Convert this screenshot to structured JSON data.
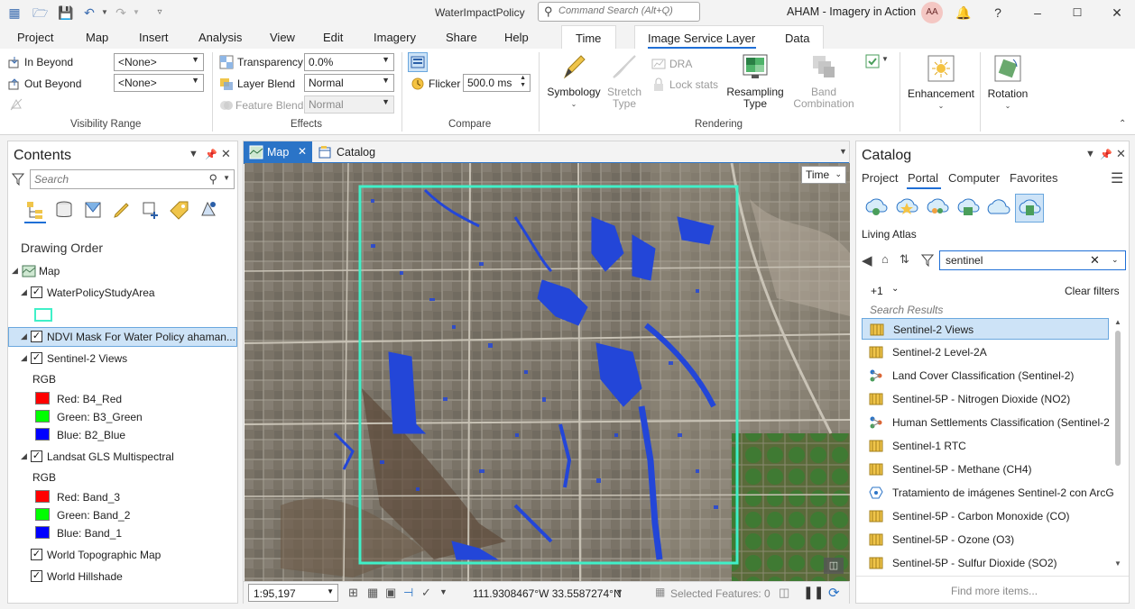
{
  "titlebar": {
    "doc_title": "WaterImpactPolicy",
    "search_placeholder": "Command Search (Alt+Q)",
    "app_title": "AHAM - Imagery in Action",
    "avatar_initials": "AA",
    "help": "?"
  },
  "ribbon_tabs": [
    "Project",
    "Map",
    "Insert",
    "Analysis",
    "View",
    "Edit",
    "Imagery",
    "Share",
    "Help",
    "Time",
    "Image Service Layer",
    "Data"
  ],
  "ribbon": {
    "visibility": {
      "in_beyond_label": "In Beyond",
      "in_beyond_value": "<None>",
      "out_beyond_label": "Out Beyond",
      "out_beyond_value": "<None>",
      "group_title": "Visibility Range"
    },
    "effects": {
      "transparency_label": "Transparency",
      "transparency_value": "0.0%",
      "layer_blend_label": "Layer Blend",
      "layer_blend_value": "Normal",
      "feature_blend_label": "Feature Blend",
      "feature_blend_value": "Normal",
      "group_title": "Effects"
    },
    "compare": {
      "flicker_label": "Flicker",
      "flicker_value": "500.0  ms",
      "group_title": "Compare"
    },
    "rendering": {
      "symbology": "Symbology",
      "stretch_type_1": "Stretch",
      "stretch_type_2": "Type",
      "dra": "DRA",
      "lock_stats": "Lock stats",
      "resampling_type_1": "Resampling",
      "resampling_type_2": "Type",
      "band_combination_1": "Band",
      "band_combination_2": "Combination",
      "group_title": "Rendering"
    },
    "enhancement": "Enhancement",
    "rotation": "Rotation"
  },
  "contents": {
    "title": "Contents",
    "search_placeholder": "Search",
    "drawing_order": "Drawing Order",
    "layers": {
      "map": "Map",
      "study_area": "WaterPolicyStudyArea",
      "ndvi": "NDVI Mask For Water Policy ahaman...",
      "sentinel_views": "Sentinel-2 Views",
      "rgb1": "RGB",
      "s_red": "Red:   B4_Red",
      "s_green": "Green: B3_Green",
      "s_blue": "Blue:  B2_Blue",
      "landsat": "Landsat GLS Multispectral",
      "rgb2": "RGB",
      "l_red": "Red:   Band_3",
      "l_green": "Green: Band_2",
      "l_blue": "Blue:  Band_1",
      "topo": "World Topographic Map",
      "hillshade": "World Hillshade"
    }
  },
  "mapview": {
    "tab_map": "Map",
    "tab_catalog": "Catalog",
    "time_button": "Time",
    "scale": "1:95,197",
    "coordinates": "111.9308467°W 33.5587274°N",
    "selected_features": "Selected Features: 0"
  },
  "catalog": {
    "title": "Catalog",
    "tabs": [
      "Project",
      "Portal",
      "Computer",
      "Favorites"
    ],
    "living_atlas": "Living Atlas",
    "search_value": "sentinel",
    "filter_count": "+1",
    "clear_filters": "Clear filters",
    "search_results_label": "Search Results",
    "results": [
      "Sentinel-2 Views",
      "Sentinel-2 Level-2A",
      "Land Cover Classification (Sentinel-2)",
      "Sentinel-5P - Nitrogen Dioxide (NO2)",
      "Human Settlements Classification (Sentinel-2",
      "Sentinel-1 RTC",
      "Sentinel-5P - Methane (CH4)",
      "Tratamiento de imágenes Sentinel-2 con ArcG",
      "Sentinel-5P - Carbon Monoxide (CO)",
      "Sentinel-5P - Ozone (O3)",
      "Sentinel-5P - Sulfur Dioxide (SO2)"
    ],
    "find_more": "Find more items..."
  },
  "colors": {
    "accent": "#1f6fd6",
    "map_tab": "#2b74c7",
    "study_area_outline": "#40f0c8",
    "water_mask": "#2346d8"
  }
}
